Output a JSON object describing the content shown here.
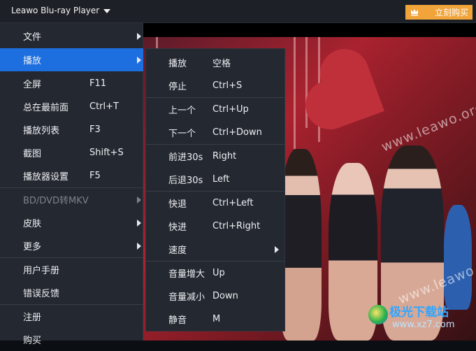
{
  "titlebar": {
    "app_title": "Leawo Blu-ray Player",
    "buy_button": "立刻购买",
    "buy_icon": "crown-icon",
    "accent_color": "#f0a43a"
  },
  "main_menu": {
    "items": [
      {
        "label": "文件",
        "shortcut": "",
        "has_submenu": true
      },
      {
        "label": "播放",
        "shortcut": "",
        "has_submenu": true,
        "active": true
      },
      {
        "label": "全屏",
        "shortcut": "F11"
      },
      {
        "label": "总在最前面",
        "shortcut": "Ctrl+T"
      },
      {
        "label": "播放列表",
        "shortcut": "F3"
      },
      {
        "label": "截图",
        "shortcut": "Shift+S"
      },
      {
        "label": "播放器设置",
        "shortcut": "F5"
      },
      {
        "label": "BD/DVD转MKV",
        "shortcut": "",
        "has_submenu": true,
        "disabled": true
      },
      {
        "label": "皮肤",
        "shortcut": "",
        "has_submenu": true
      },
      {
        "label": "更多",
        "shortcut": "",
        "has_submenu": true
      },
      {
        "label": "用户手册",
        "shortcut": ""
      },
      {
        "label": "错误反馈",
        "shortcut": ""
      },
      {
        "label": "注册",
        "shortcut": ""
      },
      {
        "label": "购买",
        "shortcut": ""
      }
    ],
    "highlight_color": "#1d6fe0"
  },
  "play_submenu": {
    "items": [
      {
        "label": "播放",
        "shortcut": "空格"
      },
      {
        "label": "停止",
        "shortcut": "Ctrl+S"
      },
      {
        "label": "上一个",
        "shortcut": "Ctrl+Up"
      },
      {
        "label": "下一个",
        "shortcut": "Ctrl+Down"
      },
      {
        "label": "前进30s",
        "shortcut": "Right"
      },
      {
        "label": "后退30s",
        "shortcut": "Left"
      },
      {
        "label": "快退",
        "shortcut": "Ctrl+Left"
      },
      {
        "label": "快进",
        "shortcut": "Ctrl+Right"
      },
      {
        "label": "速度",
        "shortcut": "",
        "has_submenu": true
      },
      {
        "label": "音量增大",
        "shortcut": "Up"
      },
      {
        "label": "音量减小",
        "shortcut": "Down"
      },
      {
        "label": "静音",
        "shortcut": "M"
      }
    ]
  },
  "video": {
    "watermark_1": "www.leawo.org",
    "watermark_2": "www.leawo.org",
    "site_brand": "极光下载站",
    "site_url": "www.xz7.com"
  }
}
